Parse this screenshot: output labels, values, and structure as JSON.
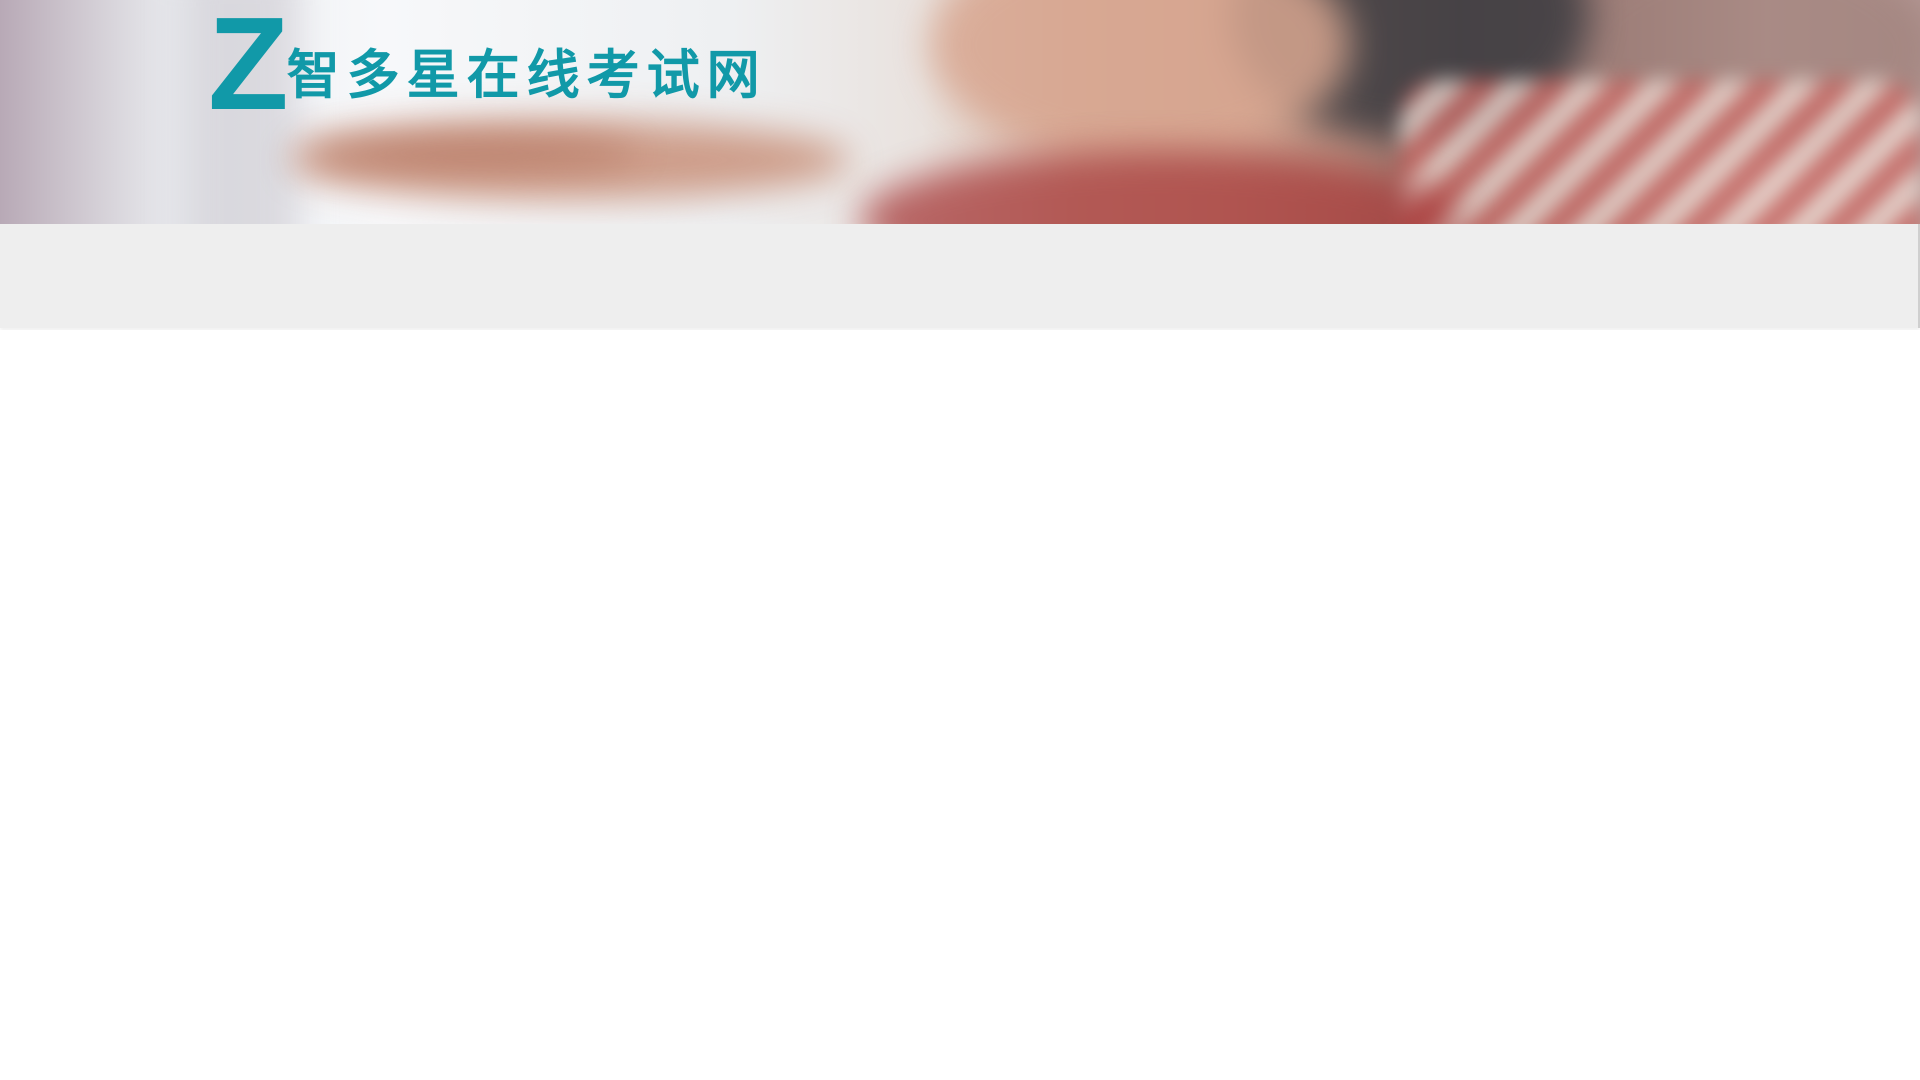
{
  "header": {
    "logo_mark": "Z",
    "site_name": "智多星在线考试网",
    "brand_color": "#1199a8"
  },
  "nav": {
    "background": "#eeeeee"
  }
}
